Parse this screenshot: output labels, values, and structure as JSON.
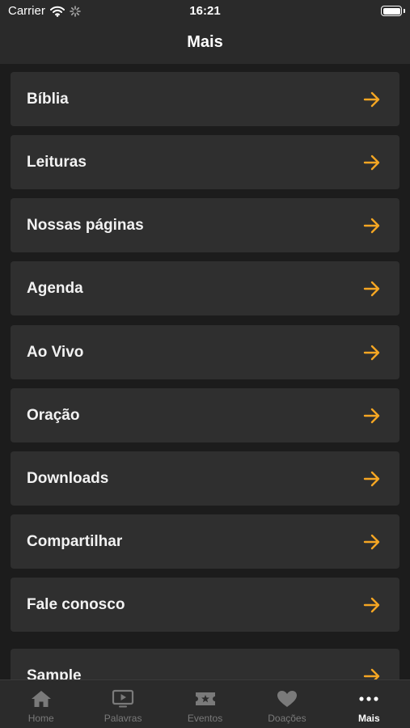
{
  "status_bar": {
    "carrier": "Carrier",
    "time": "16:21"
  },
  "nav": {
    "title": "Mais"
  },
  "colors": {
    "accent": "#f5a623",
    "background": "#1c1c1c",
    "cell": "#2f2f2f",
    "tab_inactive": "#7a7a7a"
  },
  "menu": {
    "items": [
      {
        "label": "Bíblia",
        "icon": "arrow-right-icon"
      },
      {
        "label": "Leituras",
        "icon": "arrow-right-icon"
      },
      {
        "label": "Nossas páginas",
        "icon": "arrow-right-icon"
      },
      {
        "label": "Agenda",
        "icon": "arrow-right-icon"
      },
      {
        "label": "Ao Vivo",
        "icon": "arrow-right-icon"
      },
      {
        "label": "Oração",
        "icon": "arrow-right-icon"
      },
      {
        "label": "Downloads",
        "icon": "arrow-right-icon"
      },
      {
        "label": "Compartilhar",
        "icon": "arrow-right-icon"
      },
      {
        "label": "Fale conosco",
        "icon": "arrow-right-icon"
      },
      {
        "label": "Sample",
        "icon": "arrow-right-icon"
      }
    ]
  },
  "tabs": [
    {
      "label": "Home",
      "icon": "home-icon",
      "active": false
    },
    {
      "label": "Palavras",
      "icon": "tv-play-icon",
      "active": false
    },
    {
      "label": "Eventos",
      "icon": "ticket-star-icon",
      "active": false
    },
    {
      "label": "Doações",
      "icon": "heart-icon",
      "active": false
    },
    {
      "label": "Mais",
      "icon": "more-dots-icon",
      "active": true
    }
  ]
}
